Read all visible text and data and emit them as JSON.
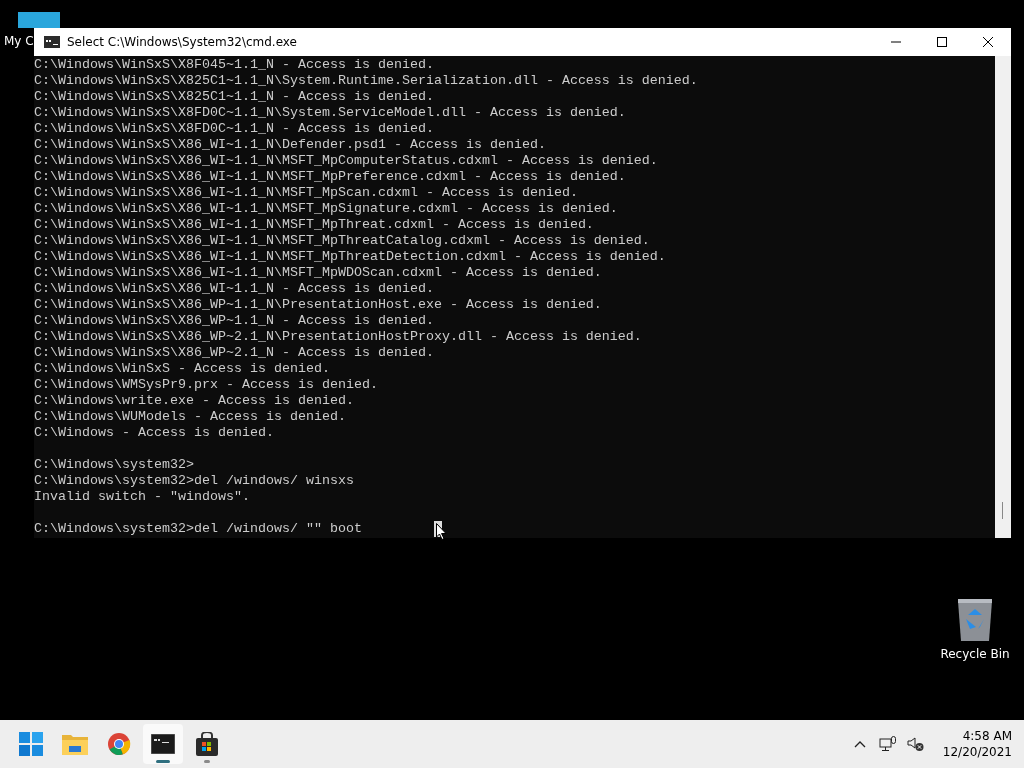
{
  "desktop_icons": [
    {
      "kind": "computer",
      "label": "My C"
    },
    {
      "kind": "recycle",
      "label": "Recycle Bin"
    }
  ],
  "window": {
    "title": "Select C:\\Windows\\System32\\cmd.exe"
  },
  "console": {
    "blocks": [
      [
        "C:\\Windows\\WinSxS\\X8F045~1.1_N - Access is denied.",
        "C:\\Windows\\WinSxS\\X825C1~1.1_N\\System.Runtime.Serialization.dll - Access is denied.",
        "C:\\Windows\\WinSxS\\X825C1~1.1_N - Access is denied.",
        "C:\\Windows\\WinSxS\\X8FD0C~1.1_N\\System.ServiceModel.dll - Access is denied.",
        "C:\\Windows\\WinSxS\\X8FD0C~1.1_N - Access is denied.",
        "C:\\Windows\\WinSxS\\X86_WI~1.1_N\\Defender.psd1 - Access is denied.",
        "C:\\Windows\\WinSxS\\X86_WI~1.1_N\\MSFT_MpComputerStatus.cdxml - Access is denied.",
        "C:\\Windows\\WinSxS\\X86_WI~1.1_N\\MSFT_MpPreference.cdxml - Access is denied.",
        "C:\\Windows\\WinSxS\\X86_WI~1.1_N\\MSFT_MpScan.cdxml - Access is denied.",
        "C:\\Windows\\WinSxS\\X86_WI~1.1_N\\MSFT_MpSignature.cdxml - Access is denied.",
        "C:\\Windows\\WinSxS\\X86_WI~1.1_N\\MSFT_MpThreat.cdxml - Access is denied.",
        "C:\\Windows\\WinSxS\\X86_WI~1.1_N\\MSFT_MpThreatCatalog.cdxml - Access is denied.",
        "C:\\Windows\\WinSxS\\X86_WI~1.1_N\\MSFT_MpThreatDetection.cdxml - Access is denied.",
        "C:\\Windows\\WinSxS\\X86_WI~1.1_N\\MSFT_MpWDOScan.cdxml - Access is denied.",
        "C:\\Windows\\WinSxS\\X86_WI~1.1_N - Access is denied.",
        "C:\\Windows\\WinSxS\\X86_WP~1.1_N\\PresentationHost.exe - Access is denied.",
        "C:\\Windows\\WinSxS\\X86_WP~1.1_N - Access is denied.",
        "C:\\Windows\\WinSxS\\X86_WP~2.1_N\\PresentationHostProxy.dll - Access is denied.",
        "C:\\Windows\\WinSxS\\X86_WP~2.1_N - Access is denied.",
        "C:\\Windows\\WinSxS - Access is denied.",
        "C:\\Windows\\WMSysPr9.prx - Access is denied.",
        "C:\\Windows\\write.exe - Access is denied.",
        "C:\\Windows\\WUModels - Access is denied.",
        "C:\\Windows - Access is denied."
      ],
      [
        "C:\\Windows\\system32>",
        "C:\\Windows\\system32>del /windows/ winsxs",
        "Invalid switch - \"windows\"."
      ],
      [
        "C:\\Windows\\system32>del /windows/ \"\" boot"
      ]
    ]
  },
  "taskbar": {
    "apps": [
      {
        "kind": "start",
        "running": false
      },
      {
        "kind": "explorer",
        "running": false
      },
      {
        "kind": "chrome",
        "running": false
      },
      {
        "kind": "terminal",
        "running": true,
        "selected": true
      },
      {
        "kind": "store",
        "running": true,
        "selected": false
      }
    ],
    "clock": {
      "time": "4:58 AM",
      "date": "12/20/2021"
    }
  }
}
